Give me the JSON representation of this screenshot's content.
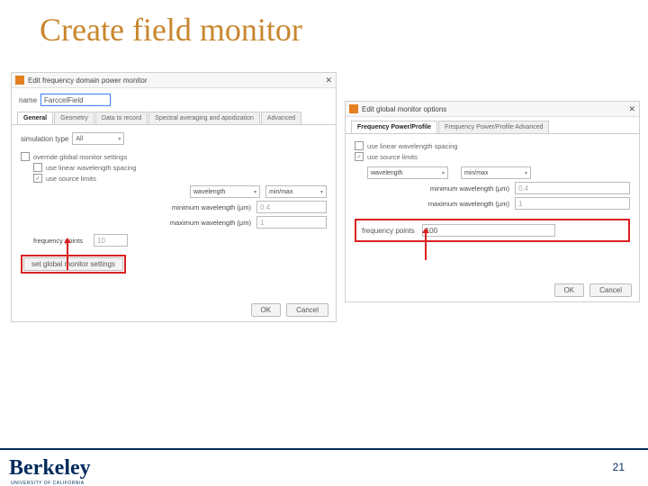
{
  "slide": {
    "title": "Create field monitor"
  },
  "left": {
    "window_title": "Edit frequency domain power monitor",
    "name_label": "name",
    "name_value": "FarccelField",
    "tabs": [
      "General",
      "Geometry",
      "Data to record",
      "Spectral averaging and apodization",
      "Advanced"
    ],
    "sim_type_label": "simulation type",
    "sim_type_value": "All",
    "override_label": "override global monitor settings",
    "linear_label": "use linear wavelength spacing",
    "source_limits_label": "use source limits",
    "wavelength_label": "wavelength",
    "minmax_value": "min/max",
    "min_wl_label": "minimum wavelength (µm)",
    "min_wl_value": "0.4",
    "max_wl_label": "maximum wavelength (µm)",
    "max_wl_value": "1",
    "freq_points_label": "frequency points",
    "freq_points_value": "10",
    "set_global_label": "set global monitor settings",
    "ok_label": "OK",
    "cancel_label": "Cancel"
  },
  "right": {
    "window_title": "Edit global monitor options",
    "tabs": [
      "Frequency Power/Profile",
      "Frequency Power/Profile Advanced"
    ],
    "linear_label": "use linear wavelength spacing",
    "source_limits_label": "use source limits",
    "wavelength_label": "wavelength",
    "minmax_value": "min/max",
    "min_wl_label": "minimum wavelength (µm)",
    "min_wl_value": "0.4",
    "max_wl_label": "maximum wavelength (µm)",
    "max_wl_value": "1",
    "freq_points_label": "frequency points",
    "freq_points_value": "100",
    "ok_label": "OK",
    "cancel_label": "Cancel"
  },
  "footer": {
    "logo": "Berkeley",
    "logo_sub": "UNIVERSITY OF CALIFORNIA",
    "page_number": "21"
  }
}
